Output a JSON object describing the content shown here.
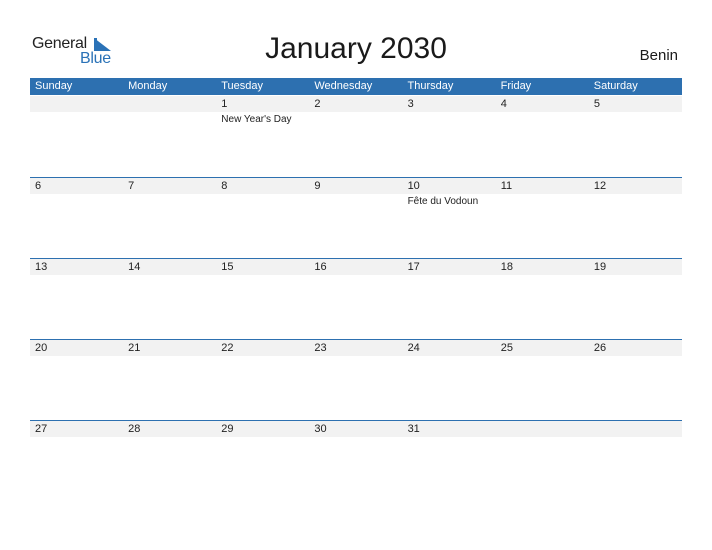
{
  "logo": {
    "text_general": "General",
    "text_blue": "Blue",
    "icon": "triangle-flag-icon",
    "accent_color": "#2a72b7"
  },
  "title": "January 2030",
  "country": "Benin",
  "header_color": "#2d70b0",
  "day_names": [
    "Sunday",
    "Monday",
    "Tuesday",
    "Wednesday",
    "Thursday",
    "Friday",
    "Saturday"
  ],
  "weeks": [
    [
      {
        "day": ""
      },
      {
        "day": ""
      },
      {
        "day": "1",
        "holiday": "New Year's Day"
      },
      {
        "day": "2"
      },
      {
        "day": "3"
      },
      {
        "day": "4"
      },
      {
        "day": "5"
      }
    ],
    [
      {
        "day": "6"
      },
      {
        "day": "7"
      },
      {
        "day": "8"
      },
      {
        "day": "9"
      },
      {
        "day": "10",
        "holiday": "Fête du Vodoun"
      },
      {
        "day": "11"
      },
      {
        "day": "12"
      }
    ],
    [
      {
        "day": "13"
      },
      {
        "day": "14"
      },
      {
        "day": "15"
      },
      {
        "day": "16"
      },
      {
        "day": "17"
      },
      {
        "day": "18"
      },
      {
        "day": "19"
      }
    ],
    [
      {
        "day": "20"
      },
      {
        "day": "21"
      },
      {
        "day": "22"
      },
      {
        "day": "23"
      },
      {
        "day": "24"
      },
      {
        "day": "25"
      },
      {
        "day": "26"
      }
    ],
    [
      {
        "day": "27"
      },
      {
        "day": "28"
      },
      {
        "day": "29"
      },
      {
        "day": "30"
      },
      {
        "day": "31"
      },
      {
        "day": ""
      },
      {
        "day": ""
      }
    ]
  ]
}
